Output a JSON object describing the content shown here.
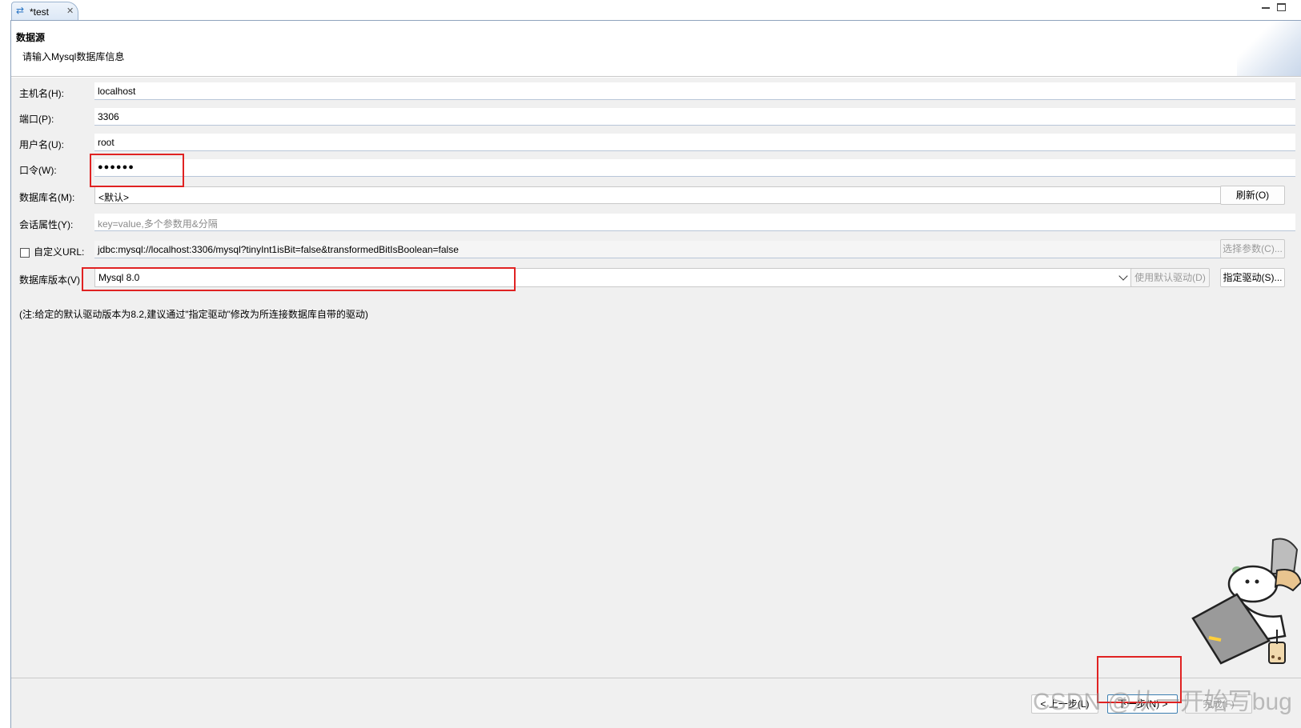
{
  "tab": {
    "title": "*test"
  },
  "header": {
    "title": "数据源",
    "description": "请输入Mysql数据库信息"
  },
  "form": {
    "host": {
      "label": "主机名(H):",
      "value": "localhost"
    },
    "port": {
      "label": "端口(P):",
      "value": "3306"
    },
    "user": {
      "label": "用户名(U):",
      "value": "root"
    },
    "password": {
      "label": "口令(W):",
      "value": "●●●●●●"
    },
    "database": {
      "label": "数据库名(M):",
      "value": "<默认>",
      "refresh_button": "刷新(O)"
    },
    "session": {
      "label": "会话属性(Y):",
      "placeholder": "key=value,多个参数用&分隔"
    },
    "custom_url": {
      "label": "自定义URL:",
      "checked": false,
      "value": "jdbc:mysql://localhost:3306/mysql?tinyInt1isBit=false&transformedBitIsBoolean=false",
      "select_params_button": "选择参数(C)..."
    },
    "db_version": {
      "label": "数据库版本(V)",
      "value": "Mysql 8.0",
      "default_driver_button": "使用默认驱动(D)",
      "specify_driver_button": "指定驱动(S)..."
    },
    "note": "(注:给定的默认驱动版本为8.2,建议通过\"指定驱动\"修改为所连接数据库自带的驱动)"
  },
  "footer": {
    "back_button": "< 上一步(L)",
    "next_button": "下一步(N) >",
    "finish_button": "完成(F)"
  },
  "watermark": "CSDN @从一开始写bug",
  "colors": {
    "highlight": "#e02222",
    "panel": "#f0f0f0",
    "accent": "#2a75c4"
  },
  "icons": {
    "tab": "connection-arrows-icon",
    "close": "close-icon",
    "minimize": "minimize-icon",
    "maximize": "maximize-icon"
  }
}
